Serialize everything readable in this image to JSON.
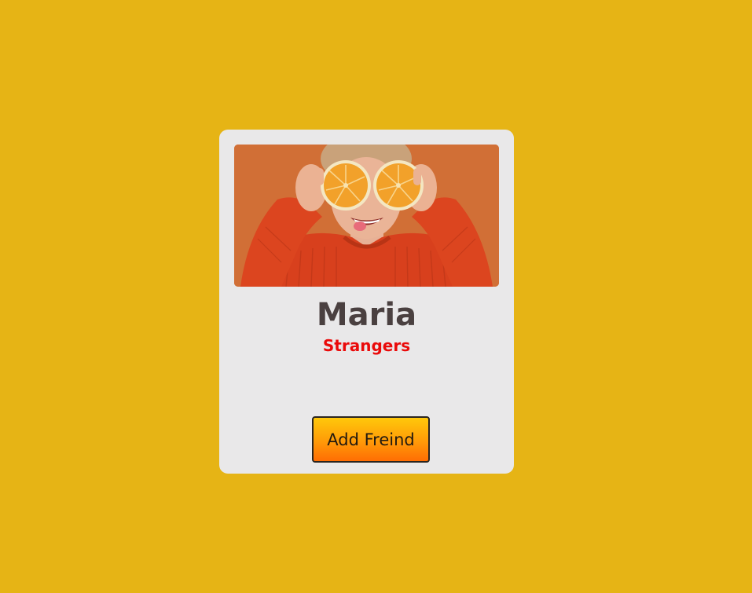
{
  "card": {
    "name": "Maria",
    "status": "Strangers",
    "button_label": "Add Freind",
    "photo_subject": "woman holding orange halves over eyes"
  },
  "colors": {
    "background": "#e6b415",
    "card": "#e9e8e9",
    "name_text": "#4a4040",
    "status_text": "#ea0a0a",
    "button_top": "#ffc80a",
    "button_bottom": "#ff6d04"
  }
}
